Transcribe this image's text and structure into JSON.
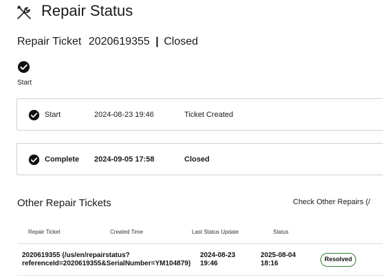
{
  "header": {
    "title": "Repair Status",
    "icon": "wrench-screwdriver-icon"
  },
  "ticket": {
    "label": "Repair Ticket",
    "number": "2020619355",
    "separator": "|",
    "status": "Closed"
  },
  "progress": {
    "steps": [
      {
        "label": "Start",
        "done": true
      }
    ]
  },
  "timeline": [
    {
      "name": "Start",
      "time": "2024-08-23 19:46",
      "description": "Ticket Created"
    },
    {
      "name": "Complete",
      "time": "2024-09-05 17:58",
      "description": "Closed"
    }
  ],
  "other": {
    "title": "Other Repair Tickets",
    "check_link": "Check Other Repairs (/",
    "columns": [
      "Repair Ticket",
      "Created Time",
      "Last Status Update",
      "Status"
    ],
    "rows": [
      {
        "ticket_line1": "2020619355 (/us/en/repairstatus?",
        "ticket_line2": "referenceId=2020619355&SerialNumber=YM104879)",
        "created_line1": "2024-08-23",
        "created_line2": "19:46",
        "updated_line1": "2025-08-04",
        "updated_line2": "18:16",
        "status": "Resolved"
      }
    ]
  },
  "colors": {
    "check_fill": "#111111",
    "badge_border": "#2e7d32",
    "card_border": "#d0d0d0"
  }
}
